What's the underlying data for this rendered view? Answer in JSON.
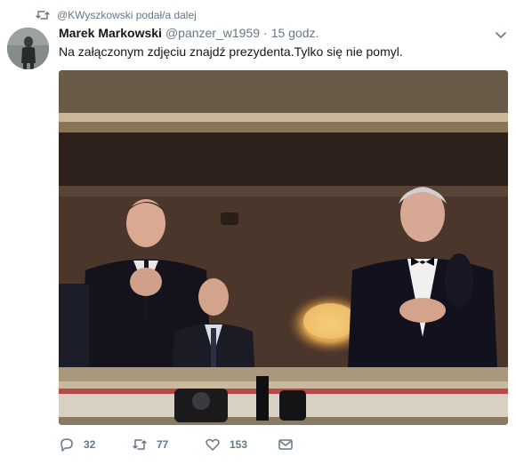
{
  "retweet_context": {
    "text": "@KWyszkowski podał/a dalej",
    "icon": "retweet-icon"
  },
  "author": {
    "fullname": "Marek Markowski",
    "username": "@panzer_w1959",
    "separator": "·",
    "time": "15 godz."
  },
  "tweet": {
    "text": "Na załączonym zdjęciu znajdź prezydenta.Tylko się nie pomyl."
  },
  "actions": {
    "reply": {
      "icon": "reply-icon",
      "count": "32"
    },
    "retweet": {
      "icon": "retweet-icon",
      "count": "77"
    },
    "like": {
      "icon": "heart-icon",
      "count": "153"
    },
    "message": {
      "icon": "envelope-icon"
    }
  },
  "colors": {
    "text_primary": "#14171a",
    "text_secondary": "#657786"
  }
}
